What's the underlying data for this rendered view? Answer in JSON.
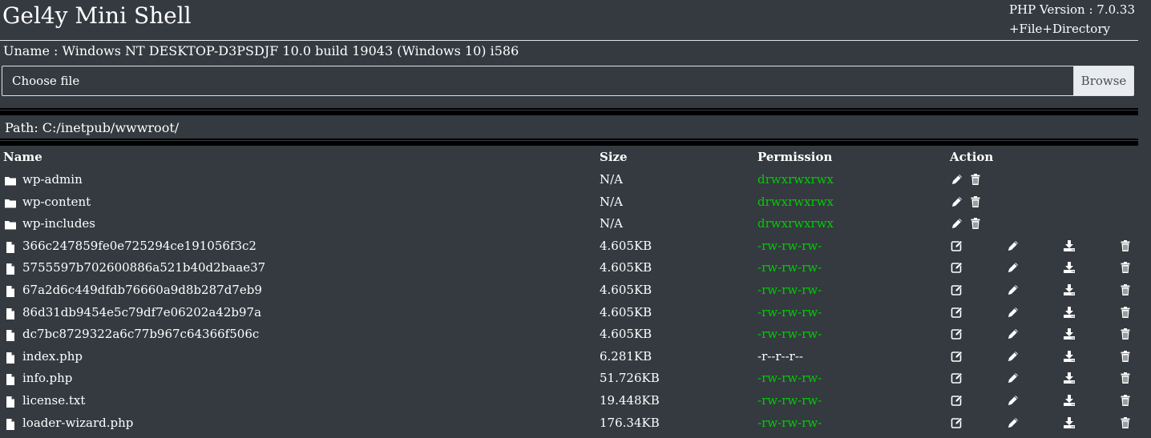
{
  "header": {
    "title": "Gel4y Mini Shell",
    "php_version": "PHP Version : 7.0.33",
    "new_item_link": "+File+Directory"
  },
  "uname": "Uname : Windows NT DESKTOP-D3PSDJF 10.0 build 19043 (Windows 10) i586",
  "upload": {
    "choose_label": "Choose file",
    "browse_label": "Browse"
  },
  "path": "Path: C:/inetpub/wwwroot/",
  "table": {
    "headers": {
      "name": "Name",
      "size": "Size",
      "permission": "Permission",
      "action": "Action"
    },
    "rows": [
      {
        "type": "dir",
        "name": "wp-admin",
        "size": "N/A",
        "perm": "drwxrwxrwx",
        "perm_color": "green"
      },
      {
        "type": "dir",
        "name": "wp-content",
        "size": "N/A",
        "perm": "drwxrwxrwx",
        "perm_color": "green"
      },
      {
        "type": "dir",
        "name": "wp-includes",
        "size": "N/A",
        "perm": "drwxrwxrwx",
        "perm_color": "green"
      },
      {
        "type": "file",
        "name": "366c247859fe0e725294ce191056f3c2",
        "size": "4.605KB",
        "perm": "-rw-rw-rw-",
        "perm_color": "green"
      },
      {
        "type": "file",
        "name": "5755597b702600886a521b40d2baae37",
        "size": "4.605KB",
        "perm": "-rw-rw-rw-",
        "perm_color": "green"
      },
      {
        "type": "file",
        "name": "67a2d6c449dfdb76660a9d8b287d7eb9",
        "size": "4.605KB",
        "perm": "-rw-rw-rw-",
        "perm_color": "green"
      },
      {
        "type": "file",
        "name": "86d31db9454e5c79df7e06202a42b97a",
        "size": "4.605KB",
        "perm": "-rw-rw-rw-",
        "perm_color": "green"
      },
      {
        "type": "file",
        "name": "dc7bc8729322a6c77b967c64366f506c",
        "size": "4.605KB",
        "perm": "-rw-rw-rw-",
        "perm_color": "green"
      },
      {
        "type": "file",
        "name": "index.php",
        "size": "6.281KB",
        "perm": "-r--r--r--",
        "perm_color": "white"
      },
      {
        "type": "file",
        "name": "info.php",
        "size": "51.726KB",
        "perm": "-rw-rw-rw-",
        "perm_color": "green"
      },
      {
        "type": "file",
        "name": "license.txt",
        "size": "19.448KB",
        "perm": "-rw-rw-rw-",
        "perm_color": "green"
      },
      {
        "type": "file",
        "name": "loader-wizard.php",
        "size": "176.34KB",
        "perm": "-rw-rw-rw-",
        "perm_color": "green"
      }
    ]
  },
  "colors": {
    "background": "#343a40",
    "perm_green": "#00cc00",
    "text": "#ffffff"
  },
  "icons": {
    "dir": "folder-icon",
    "file": "file-icon",
    "dir_actions": [
      "rename-icon",
      "delete-icon"
    ],
    "file_actions": [
      "edit-icon",
      "rename-icon",
      "download-icon",
      "delete-icon"
    ]
  }
}
